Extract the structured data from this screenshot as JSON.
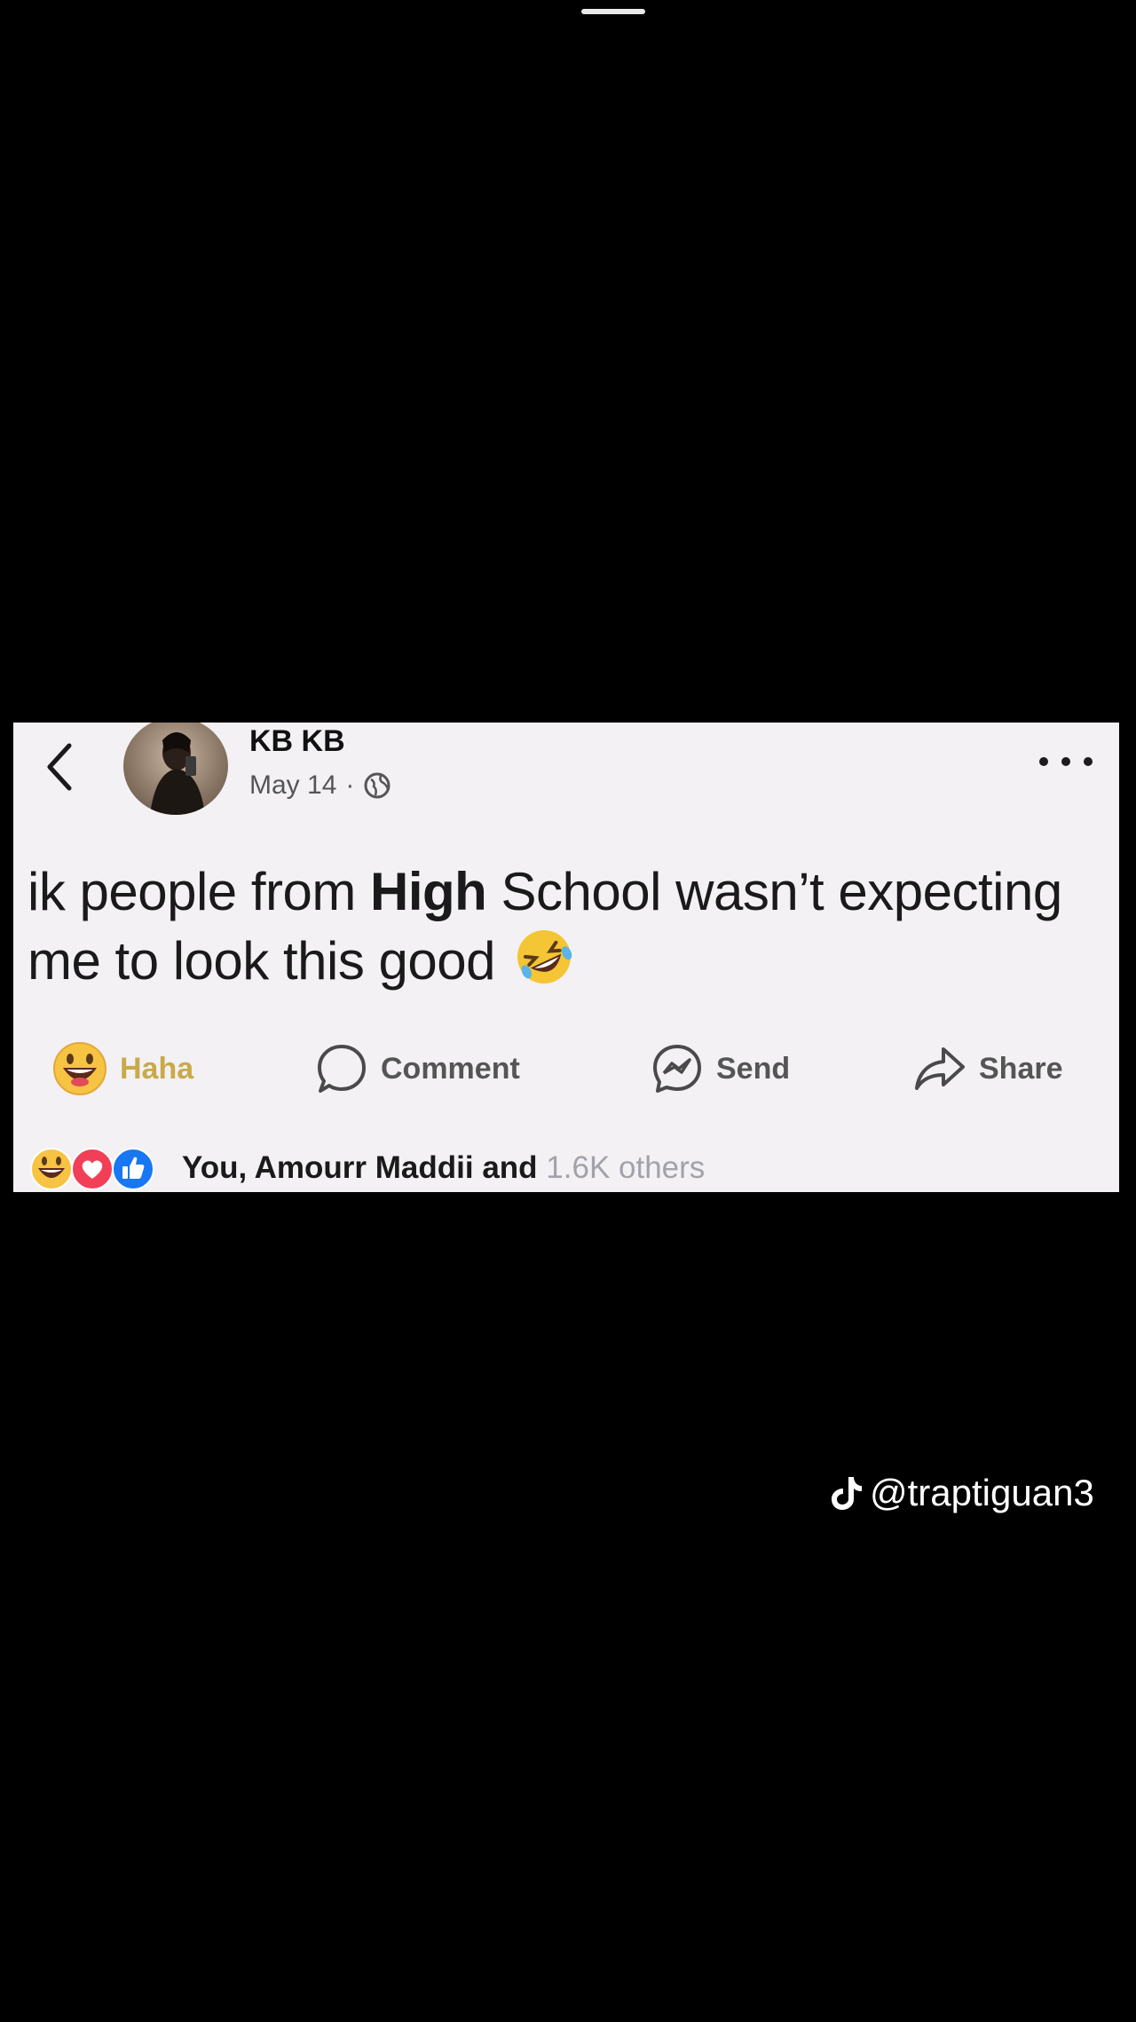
{
  "post": {
    "author_name": "KB KB",
    "date": "May 14",
    "separator": "·",
    "audience_icon": "globe-icon",
    "text_part1": "ik people from ",
    "text_bold": "High",
    "text_part2": " School wasn’t expecting me to look this good",
    "emoji": "rolling-on-floor-laughing-emoji"
  },
  "actions": {
    "haha_label": "Haha",
    "comment_label": "Comment",
    "send_label": "Send",
    "share_label": "Share"
  },
  "reactions": {
    "text": "You, Amourr Maddii and",
    "obscured_text": "1.6K others",
    "icons": [
      "haha-reaction-icon",
      "love-reaction-icon",
      "like-reaction-icon"
    ]
  },
  "watermark": {
    "handle": "@traptiguan3",
    "icon": "tiktok-icon"
  },
  "colors": {
    "background": "#000000",
    "card": "#f3f1f4",
    "haha_accent": "#c9a94a",
    "like_blue": "#1877f2",
    "love_red": "#f33e58"
  }
}
